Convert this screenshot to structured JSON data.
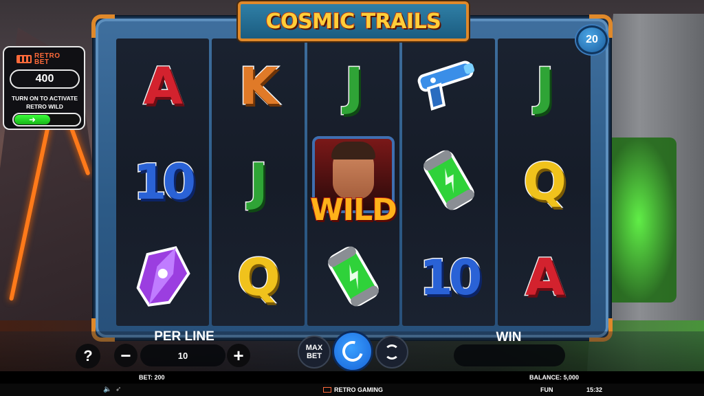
{
  "game": {
    "title": "COSMIC TRAILS",
    "paylines": "20"
  },
  "retro_bet": {
    "logo_line1": "RETRO",
    "logo_line2": "BET",
    "value": "400",
    "hint": "TURN ON TO ACTIVATE RETRO WILD",
    "toggle_arrow": "➜"
  },
  "reels": [
    [
      {
        "symbol": "A",
        "color": "red"
      },
      {
        "symbol": "10",
        "color": "blue"
      },
      {
        "symbol": "gem-icon",
        "color": "purple"
      }
    ],
    [
      {
        "symbol": "K",
        "color": "orange"
      },
      {
        "symbol": "J",
        "color": "green"
      },
      {
        "symbol": "Q",
        "color": "yellow"
      }
    ],
    [
      {
        "symbol": "J",
        "color": "green"
      },
      {
        "symbol": "WILD",
        "color": "gold"
      },
      {
        "symbol": "battery-icon",
        "color": "green"
      }
    ],
    [
      {
        "symbol": "laser-gun-icon",
        "color": "blue"
      },
      {
        "symbol": "battery-icon",
        "color": "green"
      },
      {
        "symbol": "10",
        "color": "blue"
      }
    ],
    [
      {
        "symbol": "J",
        "color": "green"
      },
      {
        "symbol": "Q",
        "color": "yellow"
      },
      {
        "symbol": "A",
        "color": "red"
      }
    ]
  ],
  "controls": {
    "help": "?",
    "per_line_label": "PER LINE",
    "minus": "−",
    "plus": "+",
    "per_line_value": "10",
    "max_bet_line1": "MAX",
    "max_bet_line2": "BET",
    "win_label": "WIN",
    "win_value": ""
  },
  "status": {
    "bet": "BET: 200",
    "balance": "BALANCE: 5,000",
    "brand": "RETRO GAMING",
    "mode": "FUN",
    "time": "15:32"
  },
  "colors": {
    "frame": "#2c5a86",
    "accent": "#e0892a",
    "spin": "#1763d8",
    "retro": "#ff6a3a",
    "toggle_on": "#16b416"
  }
}
